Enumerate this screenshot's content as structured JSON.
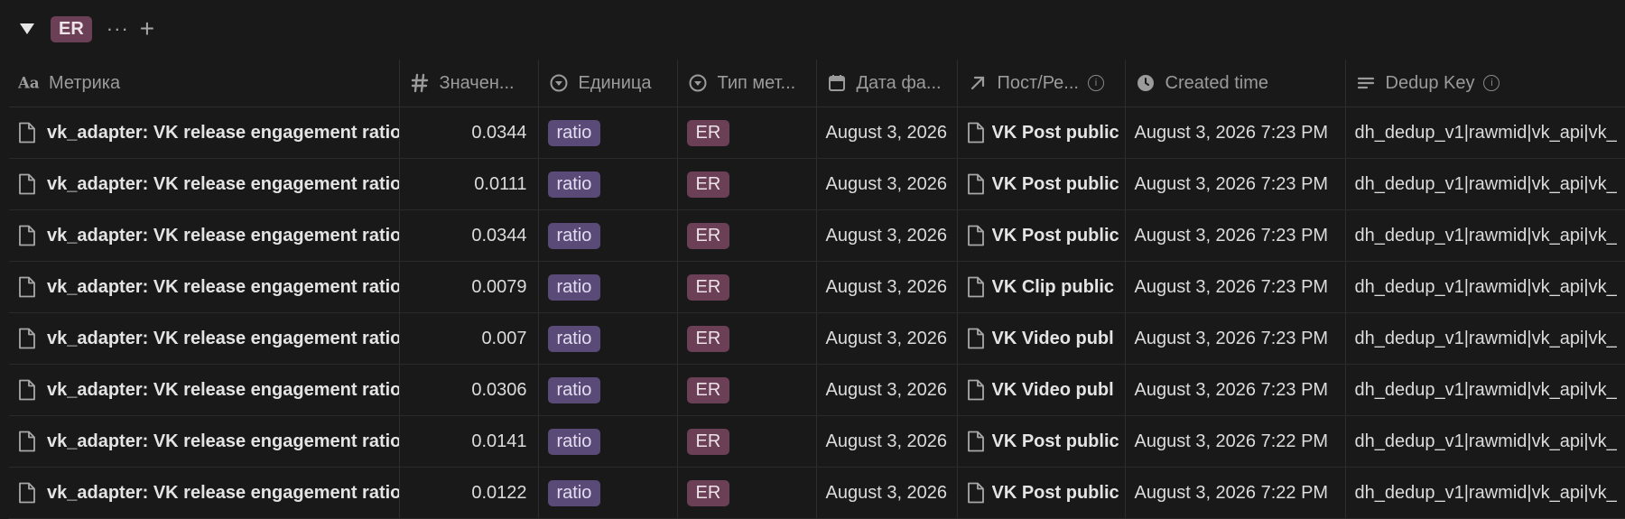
{
  "group": {
    "tag": "ER",
    "more": "···",
    "add": "+"
  },
  "columns": [
    {
      "label": "Метрика",
      "icon": "text-aa-icon"
    },
    {
      "label": "Значен...",
      "icon": "number-hash-icon"
    },
    {
      "label": "Единица",
      "icon": "select-icon"
    },
    {
      "label": "Тип мет...",
      "icon": "select-icon"
    },
    {
      "label": "Дата фа...",
      "icon": "calendar-icon"
    },
    {
      "label": "Пост/Ре...",
      "icon": "relation-arrow-icon"
    },
    {
      "label": "Created time",
      "icon": "clock-icon"
    },
    {
      "label": "Dedup Key",
      "icon": "text-lines-icon"
    }
  ],
  "rows": [
    {
      "metric": "vk_adapter: VK release engagement ratio",
      "value": "0.0344",
      "unit": "ratio",
      "type": "ER",
      "date": "August 3, 2026",
      "post": "VK Post public",
      "created": "August 3, 2026 7:23 PM",
      "dedup": "dh_dedup_v1|rawmid|vk_api|vk_"
    },
    {
      "metric": "vk_adapter: VK release engagement ratio",
      "value": "0.0111",
      "unit": "ratio",
      "type": "ER",
      "date": "August 3, 2026",
      "post": "VK Post public",
      "created": "August 3, 2026 7:23 PM",
      "dedup": "dh_dedup_v1|rawmid|vk_api|vk_"
    },
    {
      "metric": "vk_adapter: VK release engagement ratio",
      "value": "0.0344",
      "unit": "ratio",
      "type": "ER",
      "date": "August 3, 2026",
      "post": "VK Post public",
      "created": "August 3, 2026 7:23 PM",
      "dedup": "dh_dedup_v1|rawmid|vk_api|vk_"
    },
    {
      "metric": "vk_adapter: VK release engagement ratio",
      "value": "0.0079",
      "unit": "ratio",
      "type": "ER",
      "date": "August 3, 2026",
      "post": "VK Clip public",
      "created": "August 3, 2026 7:23 PM",
      "dedup": "dh_dedup_v1|rawmid|vk_api|vk_"
    },
    {
      "metric": "vk_adapter: VK release engagement ratio",
      "value": "0.007",
      "unit": "ratio",
      "type": "ER",
      "date": "August 3, 2026",
      "post": "VK Video publ",
      "created": "August 3, 2026 7:23 PM",
      "dedup": "dh_dedup_v1|rawmid|vk_api|vk_"
    },
    {
      "metric": "vk_adapter: VK release engagement ratio",
      "value": "0.0306",
      "unit": "ratio",
      "type": "ER",
      "date": "August 3, 2026",
      "post": "VK Video publ",
      "created": "August 3, 2026 7:23 PM",
      "dedup": "dh_dedup_v1|rawmid|vk_api|vk_"
    },
    {
      "metric": "vk_adapter: VK release engagement ratio",
      "value": "0.0141",
      "unit": "ratio",
      "type": "ER",
      "date": "August 3, 2026",
      "post": "VK Post public",
      "created": "August 3, 2026 7:22 PM",
      "dedup": "dh_dedup_v1|rawmid|vk_api|vk_"
    },
    {
      "metric": "vk_adapter: VK release engagement ratio",
      "value": "0.0122",
      "unit": "ratio",
      "type": "ER",
      "date": "August 3, 2026",
      "post": "VK Post public",
      "created": "August 3, 2026 7:22 PM",
      "dedup": "dh_dedup_v1|rawmid|vk_api|vk_"
    }
  ],
  "colors": {
    "background": "#191919",
    "ratio_pill": "#5a4a78",
    "er_pill": "#6b3f56"
  }
}
